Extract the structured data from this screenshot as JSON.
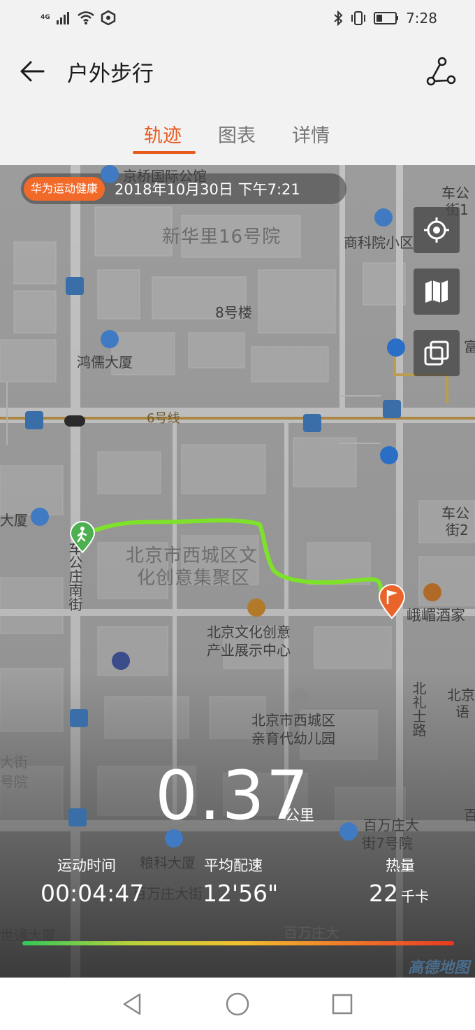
{
  "status_bar": {
    "network": "4G",
    "time": "7:28",
    "icons": [
      "signal-icon",
      "wifi-icon",
      "hd-icon",
      "bluetooth-icon",
      "vibrate-icon",
      "battery-icon"
    ]
  },
  "header": {
    "title": "户外步行",
    "back_icon": "arrow-left-icon",
    "route_icon": "route-icon"
  },
  "tabs": [
    {
      "label": "轨迹",
      "active": true
    },
    {
      "label": "图表",
      "active": false
    },
    {
      "label": "详情",
      "active": false
    }
  ],
  "map": {
    "brand": "华为运动健康",
    "date": "2018年10月30日 下午7:21",
    "controls": [
      "locate-icon",
      "map-mode-icon",
      "layers-icon"
    ],
    "labels": {
      "l1": "京桥国际公馆",
      "l2": "新华里16号院",
      "l3": "商科院小区",
      "l4": "8号楼",
      "l5": "鸿儒大厦",
      "l6": "6号线",
      "l7": "大厦",
      "l8": "北京市西城区文",
      "l9": "化创意集聚区",
      "l10": "峨嵋酒家",
      "l11": "北京文化创意",
      "l12": "产业展示中心",
      "l13": "北京市西城区",
      "l14": "亲育代幼儿园",
      "l15": "百万庄大",
      "l16": "街7号院",
      "l17": "粮科大厦",
      "l18": "百万庄大街",
      "l19": "世通大厦",
      "l20": "百万庄大",
      "l21": "车公",
      "l22": "街1",
      "l23": "富通",
      "l24": "车公",
      "l25": "街2",
      "l26": "北京",
      "l27": "语",
      "l28": "大街",
      "l29": "号院",
      "l30": "车公庄南街",
      "l31": "北礼士路",
      "l32": "百"
    },
    "amap": "高德地图"
  },
  "stats": {
    "distance": "0.37",
    "distance_unit": "公里",
    "time_label": "运动时间",
    "time_value": "00:04:47",
    "pace_label": "平均配速",
    "pace_value": "12'56\"",
    "calories_label": "热量",
    "calories_value": "22",
    "calories_unit": "千卡"
  },
  "nav": [
    "back-triangle-icon",
    "home-circle-icon",
    "recents-square-icon"
  ],
  "colors": {
    "accent": "#e65a1e",
    "track": "#7ee22a",
    "end_pin": "#e8642a",
    "start_pin": "#4caf50"
  }
}
